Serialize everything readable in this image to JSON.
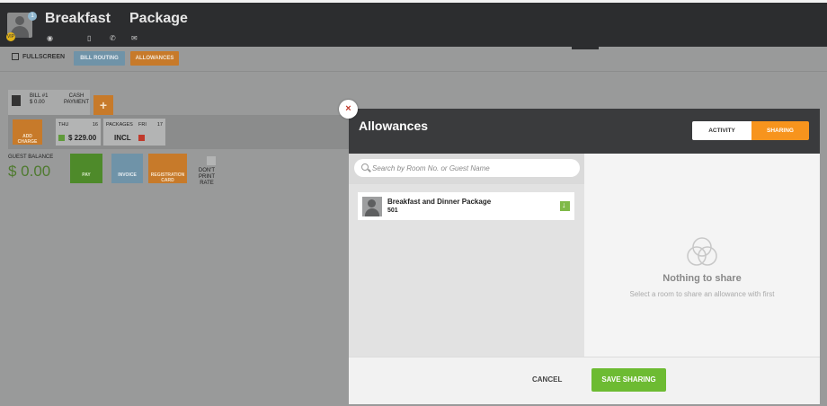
{
  "header": {
    "guest_first_name": "Breakfast",
    "guest_last_name": "Package",
    "avatar_badge": "1",
    "vip_badge": "VIP",
    "icons": [
      "location-icon",
      "phone-icon",
      "mobile-icon",
      "email-icon"
    ]
  },
  "toolbar": {
    "fullscreen_label": "FULLSCREEN",
    "bill_routing_label": "BILL ROUTING",
    "allowances_label": "ALLOWANCES"
  },
  "bill": {
    "bill_label": "BILL #1",
    "bill_amount": "$ 0.00",
    "cash_label": "CASH PAYMENT",
    "add_bill_label": "+",
    "add_charge_label": "ADD CHARGE"
  },
  "days": [
    {
      "day": "THU",
      "date": "16",
      "value": "$ 229.00"
    },
    {
      "day": "PACKAGES",
      "date": "",
      "value": "INCL"
    },
    {
      "day": "FRI",
      "date": "17",
      "value": ""
    }
  ],
  "balance": {
    "label": "GUEST BALANCE",
    "value": "$ 0.00"
  },
  "actions": {
    "pay": "PAY",
    "invoice": "INVOICE",
    "registration": "REGISTRATION CARD",
    "no_print": "DON'T PRINT RATE"
  },
  "modal": {
    "title": "Allowances",
    "segments": {
      "activity": "ACTIVITY",
      "sharing": "SHARING"
    },
    "close": "×",
    "search_placeholder": "Search by Room No. or Guest Name",
    "rooms": [
      {
        "name": "Breakfast and Dinner Package",
        "number": "501"
      }
    ],
    "empty_title": "Nothing to share",
    "empty_subtitle": "Select a room to share an allowance with first",
    "cancel_label": "CANCEL",
    "save_label": "SAVE SHARING"
  },
  "colors": {
    "orange": "#f7941d",
    "green": "#6dbb32",
    "dark": "#3a3b3d"
  }
}
